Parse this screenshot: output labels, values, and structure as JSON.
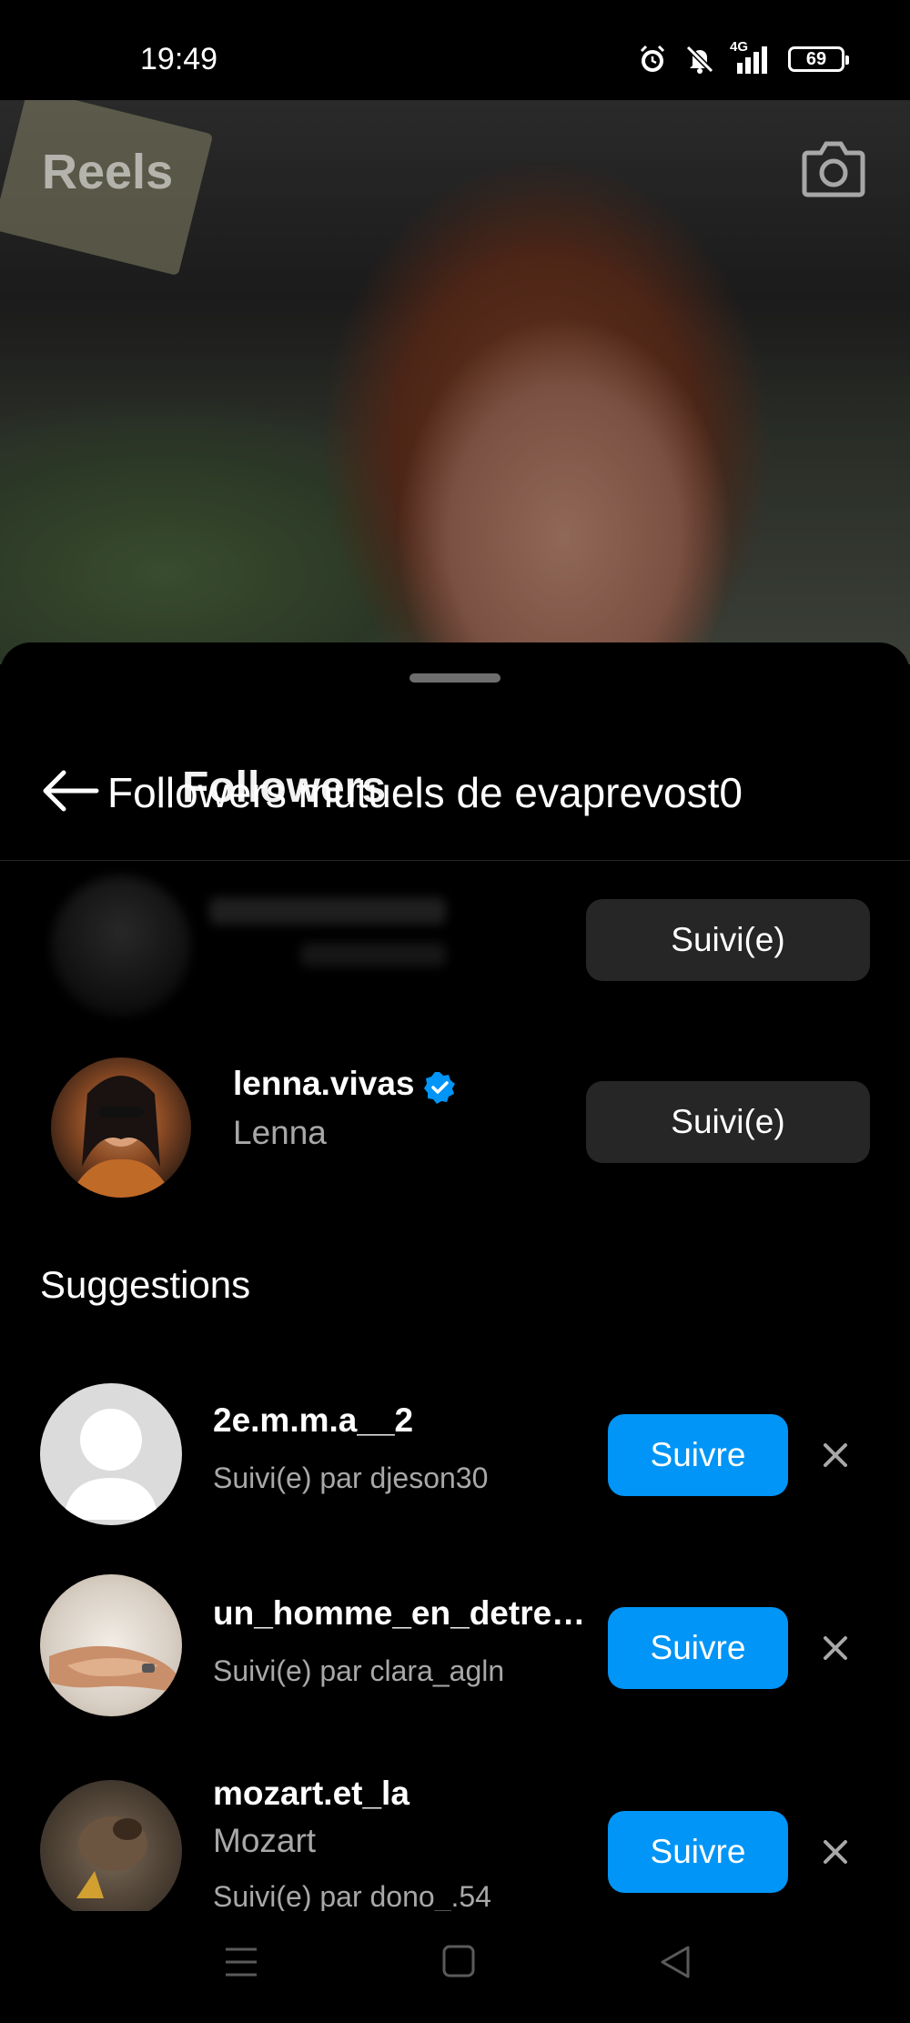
{
  "status": {
    "time": "19:49",
    "network": "4G",
    "battery": "69"
  },
  "reel": {
    "title": "Reels"
  },
  "sheet": {
    "title": "Followers mutuels de evaprevost0",
    "title_underlay": "Followers"
  },
  "mutual_followers": [
    {
      "username": "",
      "button_label": "Suivi(e)"
    },
    {
      "username": "lenna.vivas",
      "verified": true,
      "full_name": "Lenna",
      "button_label": "Suivi(e)"
    }
  ],
  "suggestions": {
    "title": "Suggestions",
    "items": [
      {
        "username": "2e.m.m.a__2",
        "subtitle": "Suivi(e) par djeson30",
        "button_label": "Suivre"
      },
      {
        "username": "un_homme_en_detre…",
        "subtitle": "Suivi(e) par clara_agln",
        "button_label": "Suivre"
      },
      {
        "username": "mozart.et_la",
        "full_name": "Mozart",
        "subtitle": "Suivi(e) par dono_.54",
        "button_label": "Suivre"
      }
    ]
  },
  "colors": {
    "follow_button": "#0095f6",
    "following_button": "#262626",
    "verified_badge": "#0095f6",
    "secondary_text": "#a8a8a8"
  }
}
